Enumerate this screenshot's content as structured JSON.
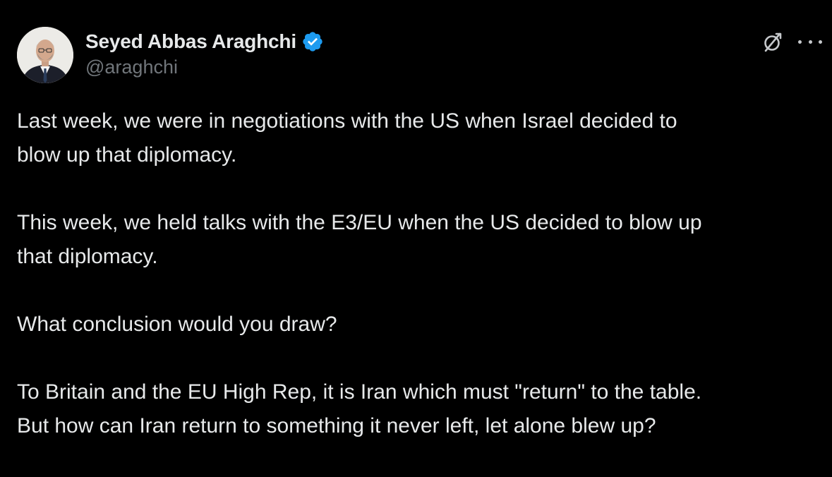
{
  "author": {
    "display_name": "Seyed Abbas Araghchi",
    "handle": "@araghchi",
    "verified": true,
    "verified_color": "#1d9bf0"
  },
  "icons": {
    "avatar": "profile-photo",
    "verified": "verified-badge-icon",
    "grok": "grok-icon",
    "more": "more-options-icon"
  },
  "tweet": {
    "paragraphs": [
      {
        "lines": [
          "Last week, we were in negotiations with the US when Israel decided to",
          "blow up that diplomacy."
        ]
      },
      {
        "lines": [
          "This week, we held talks with the E3/EU when the US decided to blow up",
          "that diplomacy."
        ]
      },
      {
        "lines": [
          "What conclusion would you draw?"
        ]
      },
      {
        "lines": [
          "To Britain and the EU High Rep, it is Iran which must \"return\" to the table.",
          "But how can Iran return to something it never left, let alone blew up?"
        ]
      }
    ]
  },
  "colors": {
    "background": "#000000",
    "text_primary": "#e7e9ea",
    "text_secondary": "#71767b"
  }
}
